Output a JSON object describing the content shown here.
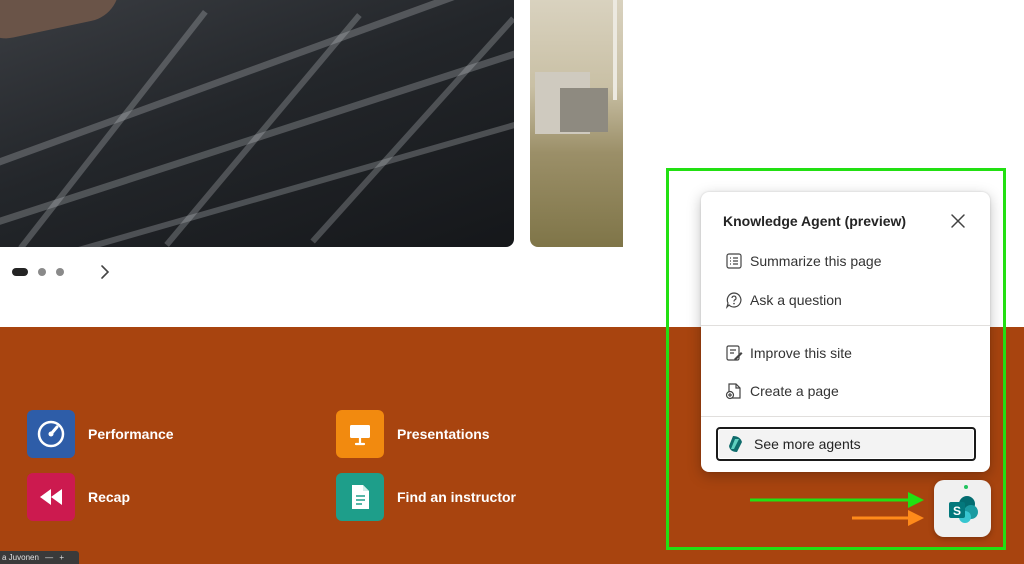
{
  "carousel": {
    "dot_count": 3,
    "active_index": 0,
    "next_icon": "chevron-right-icon"
  },
  "quick_links": [
    {
      "label": "Performance",
      "icon": "speedometer-icon",
      "color": "#2e5da8"
    },
    {
      "label": "Presentations",
      "icon": "presentation-board-icon",
      "color": "#f28a0f"
    },
    {
      "label": "Recap",
      "icon": "rewind-icon",
      "color": "#cc1a4f"
    },
    {
      "label": "Find an instructor",
      "icon": "document-icon",
      "color": "#1e9e8a"
    }
  ],
  "user_chip": {
    "text": "a Juvonen"
  },
  "agent_panel": {
    "title": "Knowledge Agent (preview)",
    "close_icon": "close-icon",
    "items": [
      {
        "label": "Summarize this page",
        "icon": "list-icon"
      },
      {
        "label": "Ask a question",
        "icon": "question-bubble-icon"
      },
      {
        "label": "Improve this site",
        "icon": "edit-site-icon"
      },
      {
        "label": "Create a page",
        "icon": "new-page-icon"
      }
    ],
    "more_button": {
      "label": "See more agents",
      "icon": "agents-logo-icon"
    }
  },
  "launcher": {
    "icon": "sharepoint-logo-icon",
    "status_color": "#22c35e"
  },
  "colors": {
    "band": "#a8440f",
    "highlight": "#22e012",
    "green_arrow": "#22e012",
    "orange_arrow": "#ff8a1a"
  }
}
